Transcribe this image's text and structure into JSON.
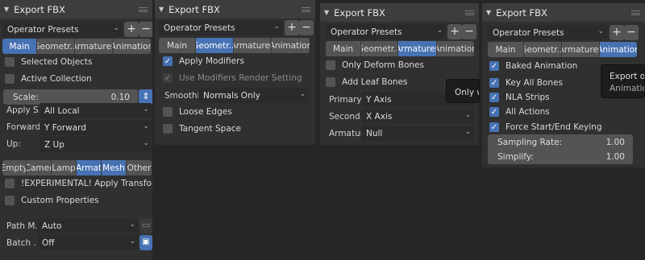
{
  "common": {
    "title": "Export FBX",
    "presets": "Operator Presets",
    "plus": "+",
    "minus": "−",
    "tabs": [
      "Main",
      "Geometr...",
      "Armatures",
      "Animation"
    ]
  },
  "p1": {
    "selected_objects": "Selected Objects",
    "active_collection": "Active Collection",
    "scale_label": "Scale:",
    "scale_value": "0.10",
    "apply_s_label": "Apply S...",
    "apply_s_value": "All Local",
    "forward_label": "Forward:",
    "forward_value": "Y Forward",
    "up_label": "Up:",
    "up_value": "Z Up",
    "types": [
      "Empty",
      "Camer",
      "Lamp",
      "Armat",
      "Mesh",
      "Other"
    ],
    "experimental": "!EXPERIMENTAL! Apply Transform",
    "custom_props": "Custom Properties",
    "path_label": "Path M...",
    "path_value": "Auto",
    "batch_label": "Batch ...",
    "batch_value": "Off"
  },
  "p2": {
    "apply_modifiers": "Apply Modifiers",
    "use_mod_render": "Use Modifiers Render Setting",
    "smoothing_label": "Smoothi...",
    "smoothing_value": "Normals Only",
    "loose_edges": "Loose Edges",
    "tangent_space": "Tangent Space"
  },
  "p3": {
    "only_deform": "Only Deform Bones",
    "add_leaf": "Add Leaf Bones",
    "primary_label": "Primary...",
    "primary_value": "Y Axis",
    "second_label": "Second...",
    "second_value": "X Axis",
    "armature_label": "Armatur...",
    "armature_value": "Null",
    "tooltip": "Only wri"
  },
  "p4": {
    "baked_anim": "Baked Animation",
    "key_all_bones": "Key All Bones",
    "nla_strips": "NLA Strips",
    "all_actions": "All Actions",
    "force_keying": "Force Start/End Keying",
    "sampling_label": "Sampling Rate:",
    "sampling_value": "1.00",
    "simplify_label": "Simplify:",
    "simplify_value": "1.00",
    "tooltip_1": "Export opti",
    "tooltip_2": "Animation"
  }
}
